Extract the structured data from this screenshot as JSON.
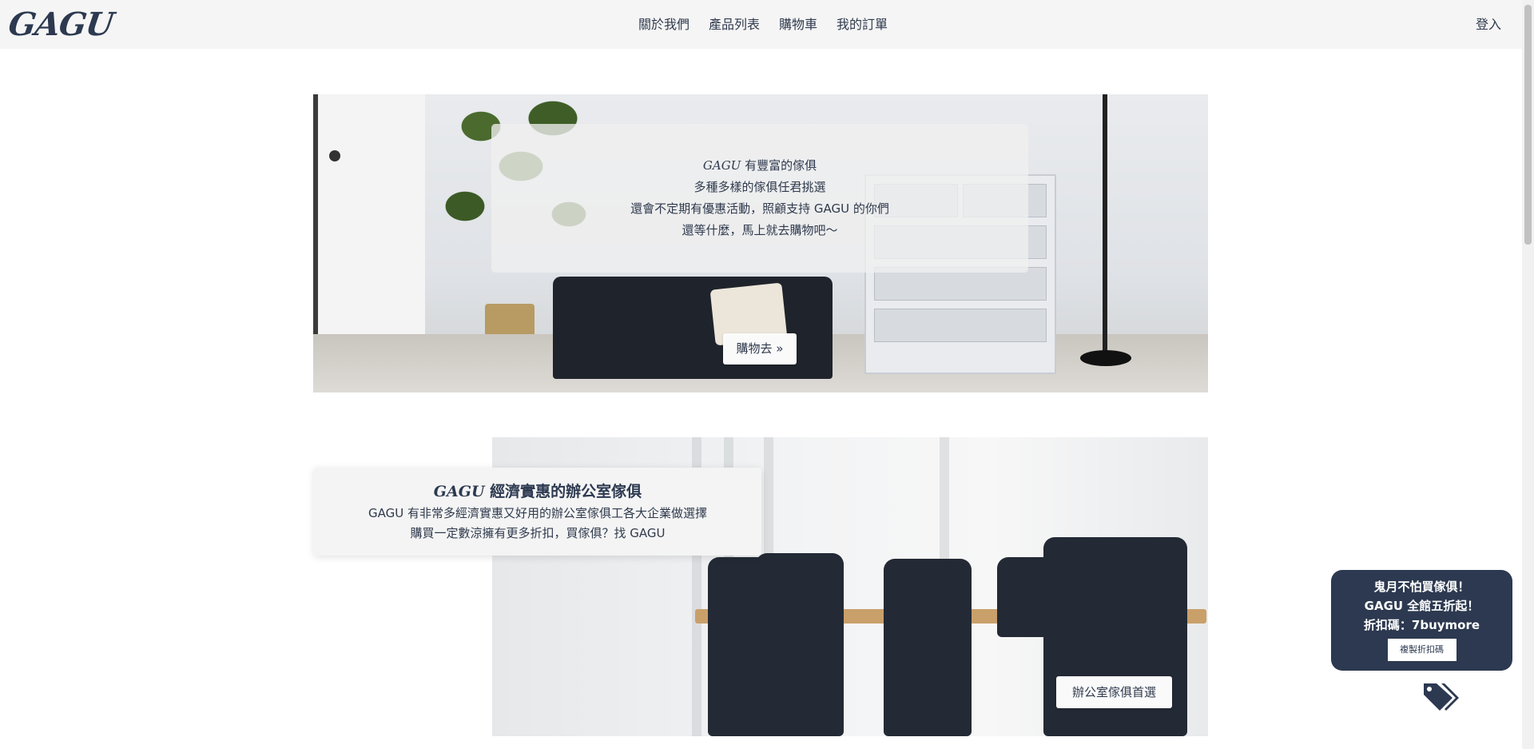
{
  "nav": {
    "logo": "GAGU",
    "items": [
      "關於我們",
      "產品列表",
      "購物車",
      "我的訂單"
    ],
    "login": "登入"
  },
  "hero": {
    "brand": "GAGU",
    "line1_rest": " 有豐富的傢俱",
    "line2": "多種多樣的傢俱任君挑選",
    "line3": "還會不定期有優惠活動，照顧支持 GAGU 的你們",
    "line4": "還等什麼，馬上就去購物吧～",
    "button": "購物去 »"
  },
  "office": {
    "title_brand": "GAGU",
    "title_rest": " 經濟實惠的辦公室傢俱",
    "desc1": "GAGU 有非常多經濟實惠又好用的辦公室傢俱工各大企業做選擇",
    "desc2": "購買一定數涼擁有更多折扣，買傢俱？找 GAGU",
    "button": "辦公室傢俱首選"
  },
  "promo": {
    "line1": "鬼月不怕買傢俱！",
    "line2": "GAGU 全館五折起！",
    "line3": "折扣碼：7buymore",
    "copy_button": "複製折扣碼",
    "icon": "tags-icon"
  },
  "colors": {
    "navy": "#2c3950",
    "nav_bg": "#f5f5f5"
  }
}
